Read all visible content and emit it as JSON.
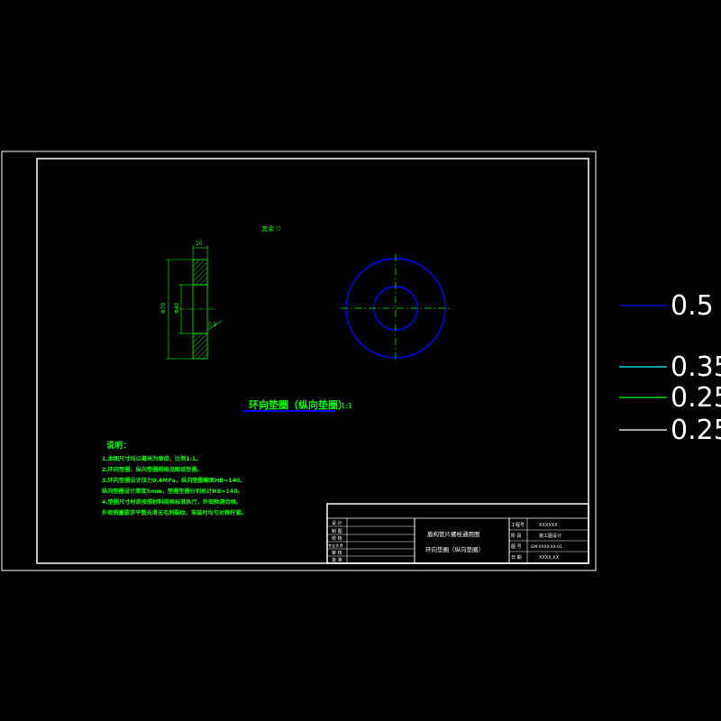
{
  "drawing": {
    "roughness_label": "其余 ▽",
    "dims": {
      "thickness": "10",
      "outer_dia": "Φ70",
      "inner_dia": "Φ40",
      "chamfer": "0.5"
    },
    "section_title": "环向垫圈（纵向垫圈）",
    "section_scale": "1:1",
    "notes_title": "说明：",
    "notes": [
      "1.本图尺寸均以毫米为单位，比例1:1。",
      "2.环向垫圈，纵向垫圈规格见图纸垫圈。",
      "3.环向垫圈设计压力0.4MPa，纵向垫圈截面HB=140。",
      "  纵向垫圈设计厚度5mm，垫圈垫圈分别总计HB=140。",
      "4.垫圈尺寸材质按照材料规格标准执行，外观检测合格。",
      "  外观质量要求平整光滑无毛刺裂纹，安装时均匀对称拧紧。"
    ]
  },
  "title_block": {
    "left_rows": [
      "设 计",
      "制 图",
      "校 核",
      "专业负责",
      "审 核",
      "批 准"
    ],
    "drawing_name_line1": "盾构管片螺栓通用图",
    "drawing_name_line2": "环向垫圈（纵向垫圈）",
    "right_labels": [
      "工程号",
      "阶 段",
      "图 号",
      "日 期"
    ],
    "right_values": [
      "XXXXXX",
      "施工图设计",
      "GM-XXXX-XX-01",
      "XXXX.XX"
    ]
  },
  "line_legend": [
    {
      "weight": "0.5",
      "color": "#0000ff"
    },
    {
      "weight": "0.35",
      "color": "#00ffff"
    },
    {
      "weight": "0.25",
      "color": "#00ff00"
    },
    {
      "weight": "0.25",
      "color": "#ffffff"
    }
  ]
}
